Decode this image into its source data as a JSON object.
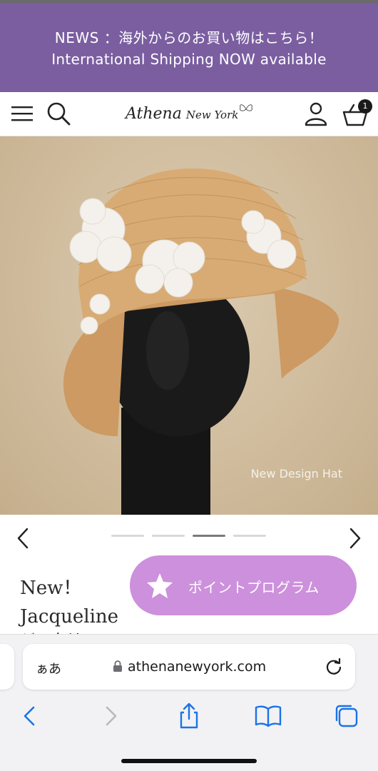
{
  "news": {
    "line1": "NEWS ：海外からのお買い物はこちら！",
    "line2": "International Shipping NOW available"
  },
  "header": {
    "brand": "Athena",
    "brand_sub": "New York",
    "cart_count": "1",
    "icons": [
      "menu-icon",
      "search-icon",
      "butterfly-icon",
      "user-icon",
      "cart-icon"
    ]
  },
  "hero": {
    "caption": "New Design Hat"
  },
  "carousel": {
    "slides": 4,
    "active_index": 2
  },
  "product": {
    "title_line1": "New！",
    "title_line2": "Jacqueline",
    "title_line3": "ジャクリーン"
  },
  "points_button": {
    "label": "ポイントプログラム",
    "icon": "star-icon"
  },
  "browser": {
    "aa_label": "ぁあ",
    "domain": "athenanewyork.com",
    "toolbar_icons": [
      "back-icon",
      "forward-icon",
      "share-icon",
      "bookmarks-icon",
      "tabs-icon"
    ]
  },
  "colors": {
    "news_bg": "#7b5ea0",
    "points_bg": "#cd90dc",
    "browser_accent": "#1a73e8"
  }
}
